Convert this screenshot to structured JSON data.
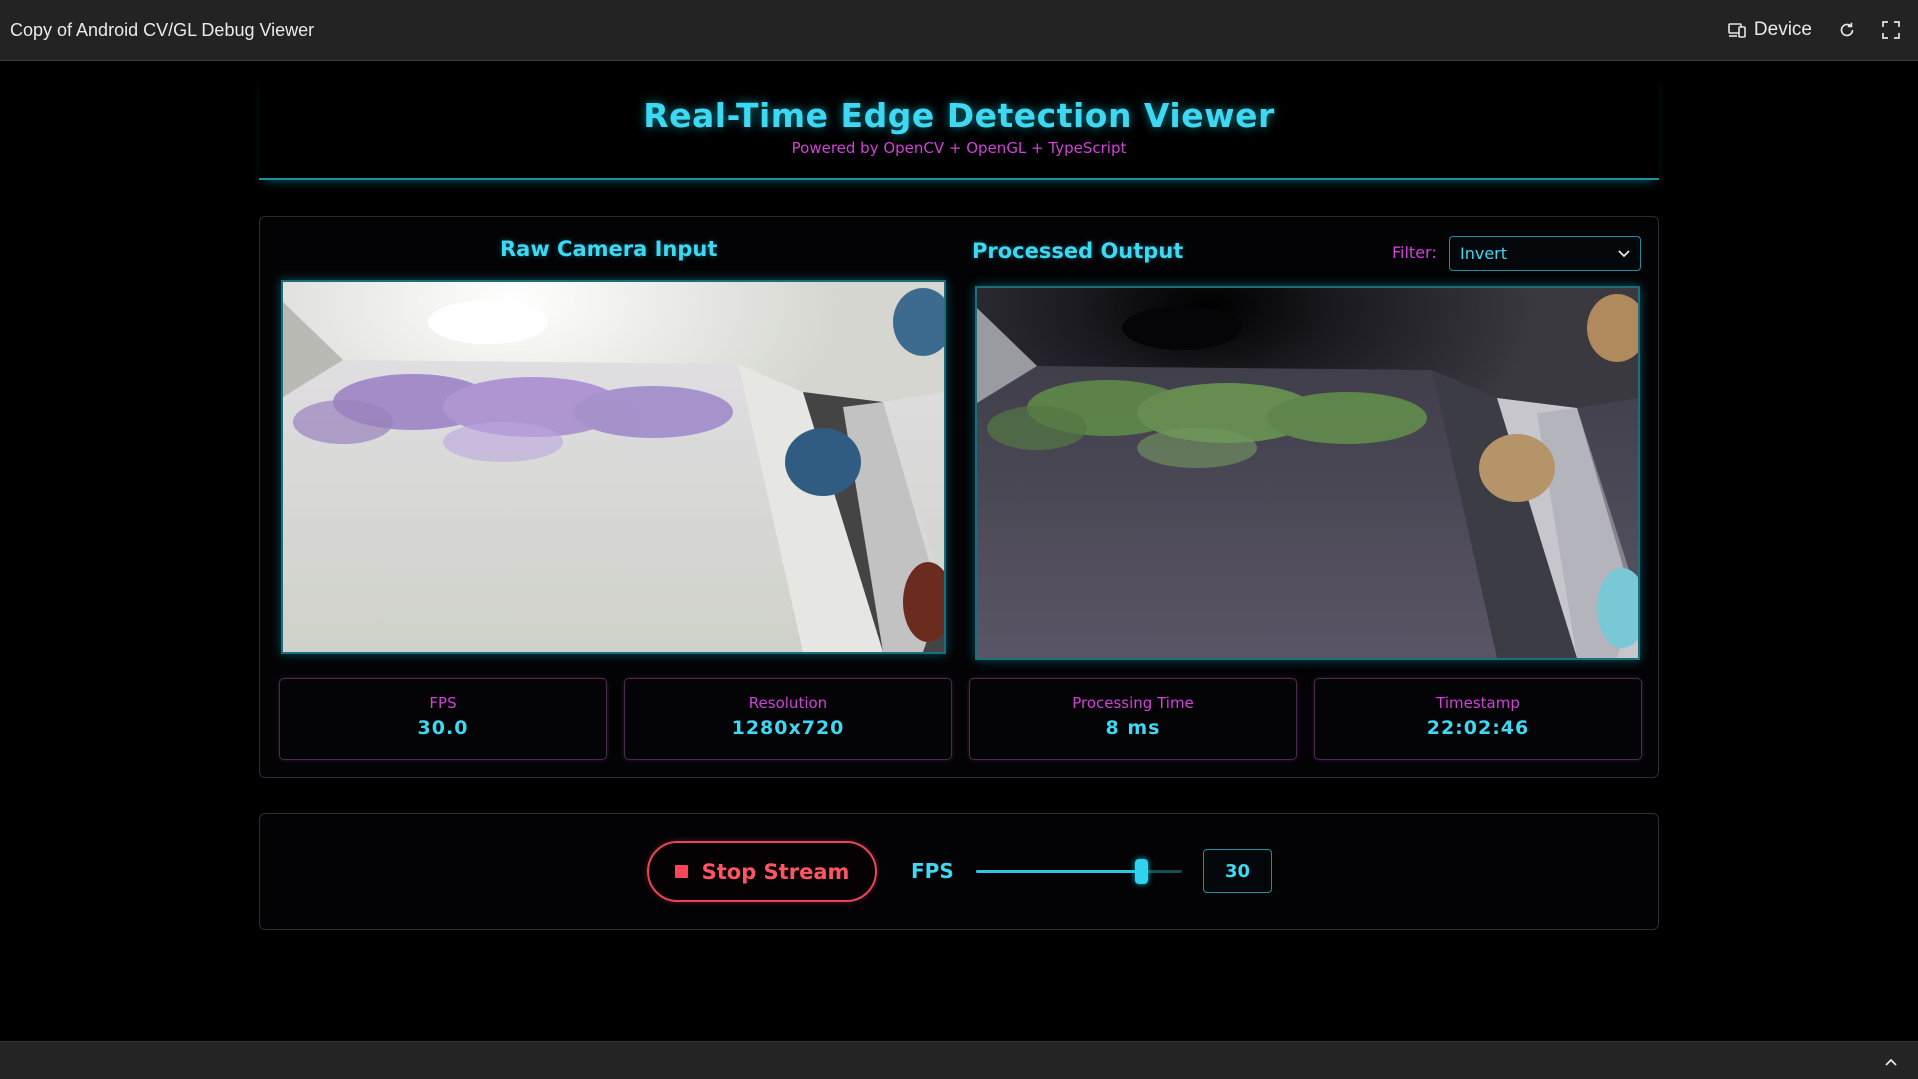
{
  "window": {
    "title": "Copy of Android CV/GL Debug Viewer",
    "device_label": "Device",
    "icons": [
      "device-icon",
      "refresh-icon",
      "fullscreen-icon",
      "chevron-up-icon"
    ]
  },
  "header": {
    "title": "Real-Time Edge Detection Viewer",
    "subtitle": "Powered by OpenCV + OpenGL + TypeScript"
  },
  "viewer": {
    "raw_title": "Raw Camera Input",
    "processed_title": "Processed Output",
    "filter_label": "Filter:",
    "filter_value": "Invert"
  },
  "stats": [
    {
      "label": "FPS",
      "value": "30.0"
    },
    {
      "label": "Resolution",
      "value": "1280x720"
    },
    {
      "label": "Processing Time",
      "value": "8 ms"
    },
    {
      "label": "Timestamp",
      "value": "22:02:46"
    }
  ],
  "controls": {
    "stop_label": "Stop Stream",
    "fps_label": "FPS",
    "fps_value": "30",
    "fps_slider_fraction": 0.8
  },
  "colors": {
    "accent_cyan": "#3fd8f2",
    "accent_magenta": "#d042d8",
    "stop_red": "#ff5563",
    "background": "#000000"
  }
}
